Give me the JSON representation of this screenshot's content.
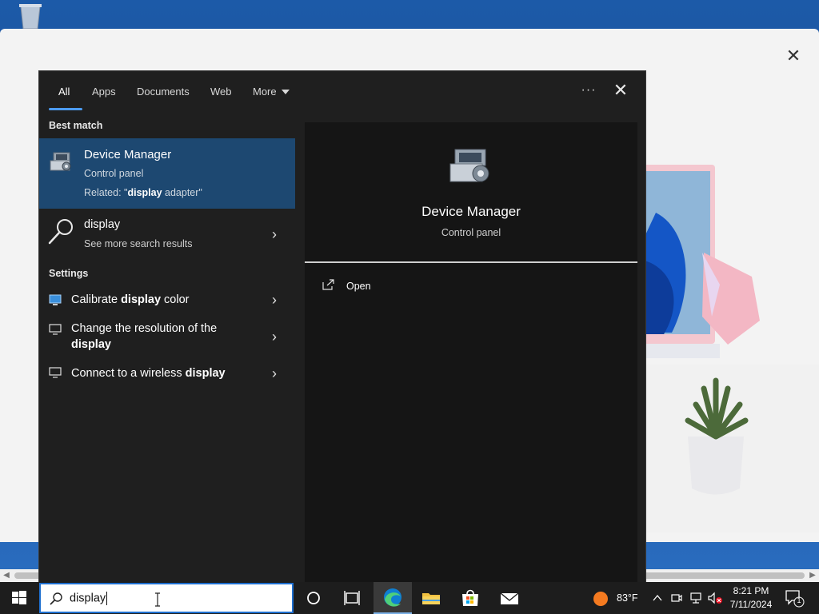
{
  "flyout": {
    "tabs": [
      {
        "label": "All"
      },
      {
        "label": "Apps"
      },
      {
        "label": "Documents"
      },
      {
        "label": "Web"
      },
      {
        "label": "More"
      }
    ],
    "ellipsis": "···",
    "close": "✕"
  },
  "results": {
    "best_match_heading": "Best match",
    "best": {
      "title": "Device Manager",
      "type": "Control panel",
      "related_prefix": "Related: \"",
      "related_bold": "display",
      "related_suffix": " adapter\""
    },
    "web": {
      "title": "display",
      "sub": "See more search results"
    },
    "settings_heading": "Settings",
    "settings": [
      {
        "pre": "Calibrate ",
        "bold": "display",
        "post": " color"
      },
      {
        "pre": "Change the resolution of the ",
        "bold": "display",
        "post": ""
      },
      {
        "pre": "Connect to a wireless ",
        "bold": "display",
        "post": ""
      }
    ]
  },
  "preview": {
    "title": "Device Manager",
    "type": "Control panel",
    "open_label": "Open"
  },
  "taskbar": {
    "search_value": "display",
    "weather_temp": "83°F",
    "time": "8:21 PM",
    "date": "7/11/2024",
    "notification_count": "1"
  },
  "background_window": {
    "close": "✕"
  },
  "colors": {
    "accent": "#4c9bf0",
    "selected_bg": "#1d4871",
    "flyout_bg": "#1f1f1f",
    "taskbar_bg": "#1d1d1d"
  }
}
